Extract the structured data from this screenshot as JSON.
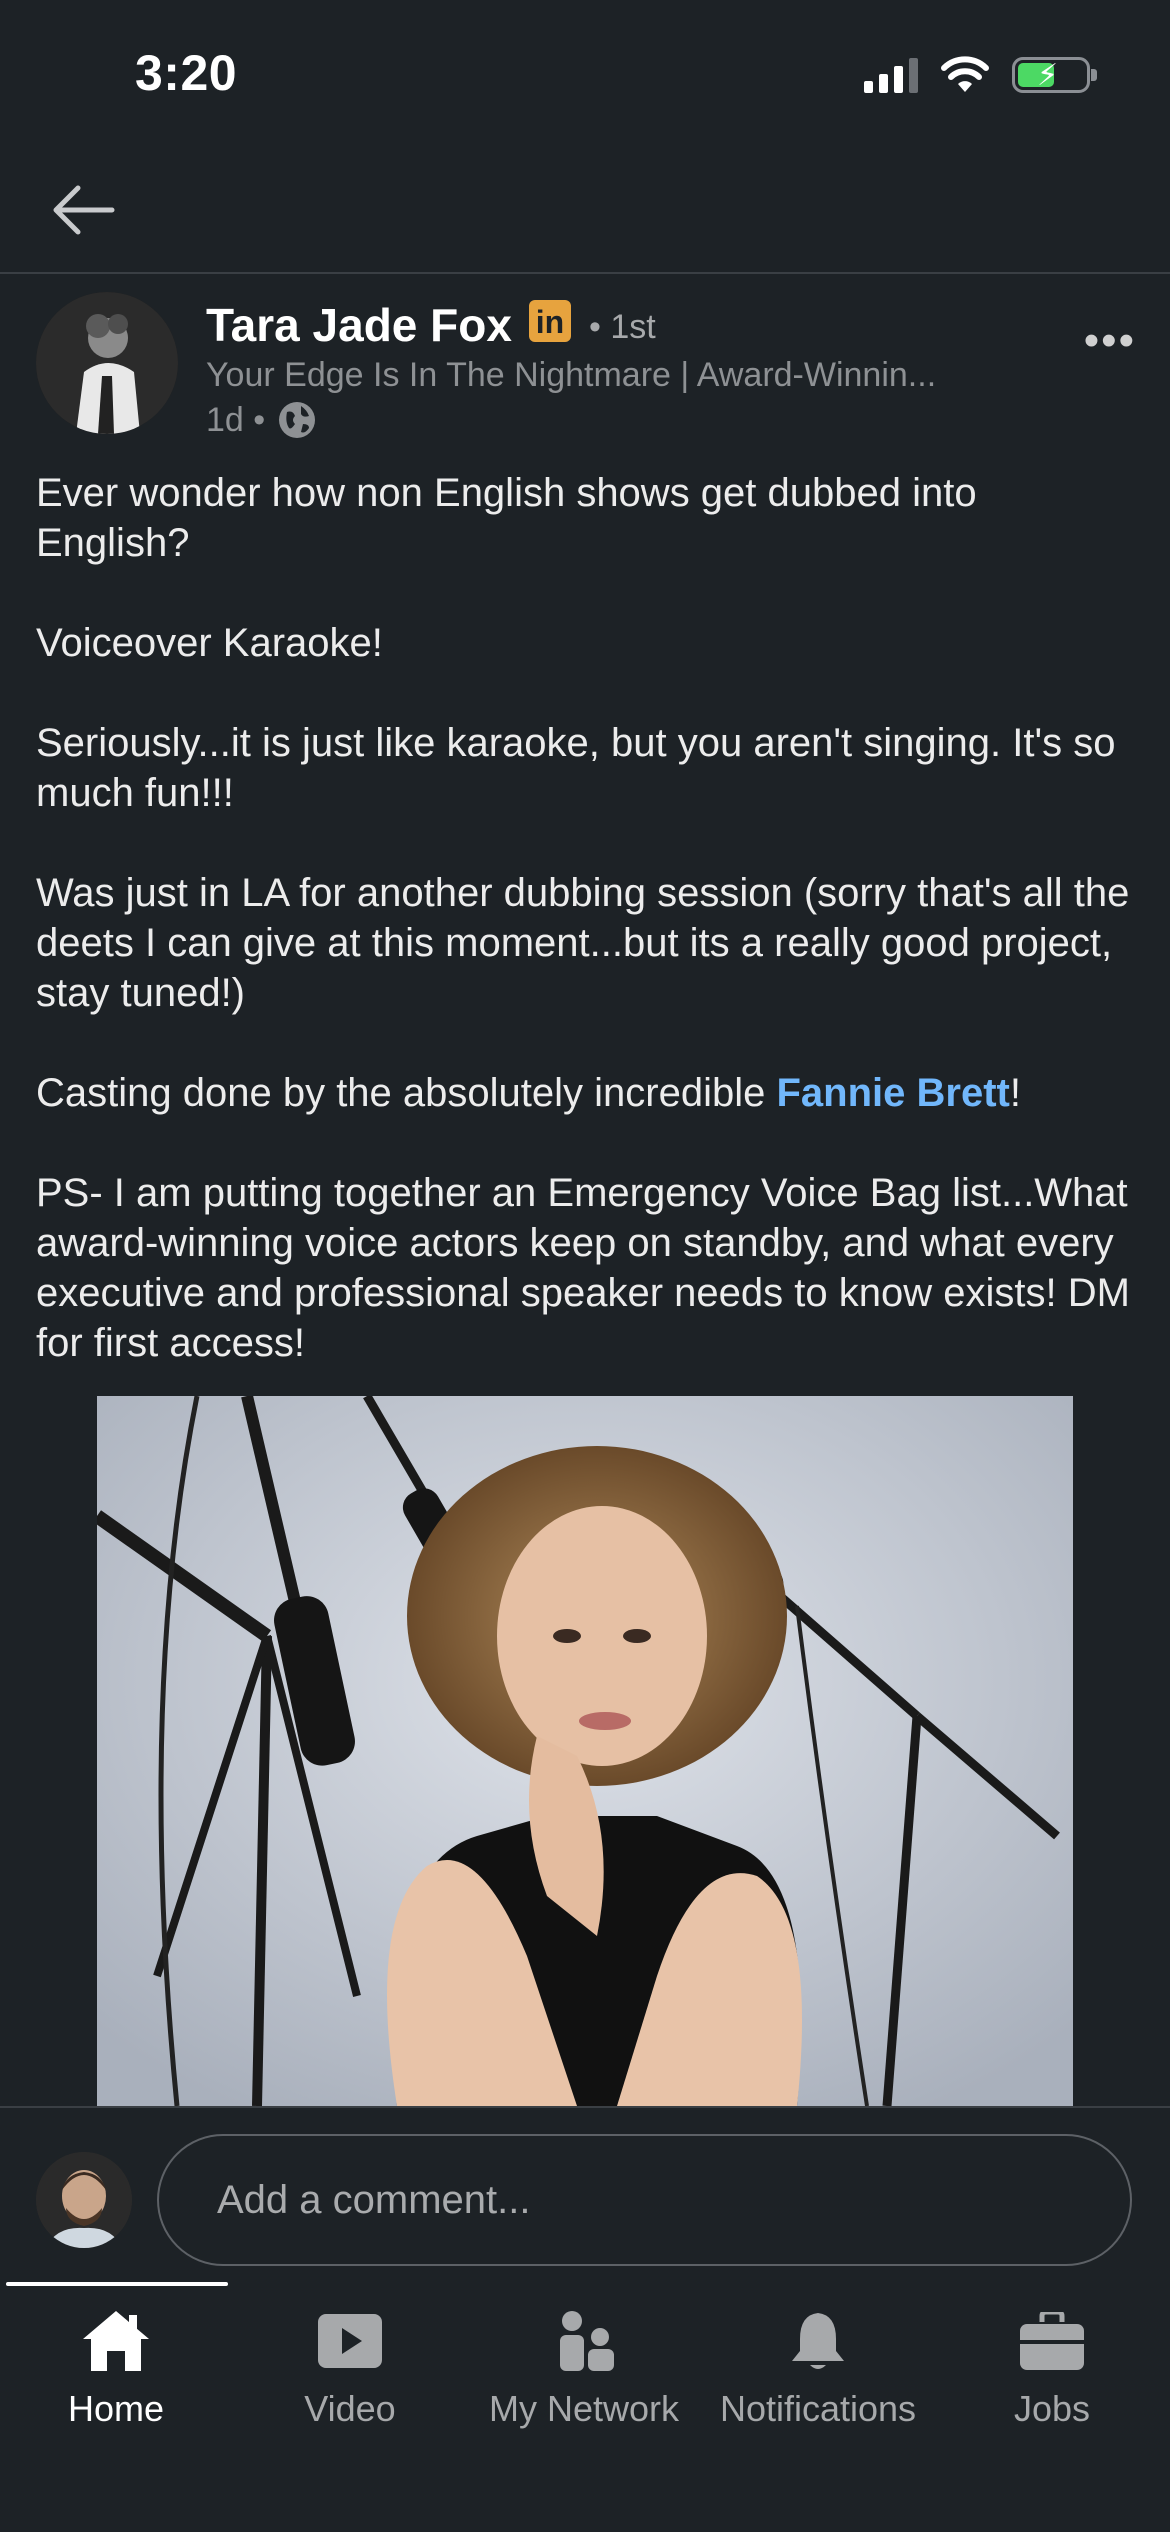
{
  "status_bar": {
    "time": "3:20"
  },
  "post": {
    "author_name": "Tara Jade Fox",
    "badge": "in",
    "degree": "• 1st",
    "headline": "Your Edge Is In The Nightmare  | Award-Winnin...",
    "age": "1d •",
    "paragraphs": [
      "Ever wonder how non English shows get dubbed into English?",
      "Voiceover Karaoke!",
      "Seriously...it is just like karaoke, but you aren't singing. It's so much fun!!!",
      "Was just in LA for another dubbing session (sorry that's all the deets I can give at this moment...but its a really good project, stay tuned!)",
      "PS- I am putting together an Emergency Voice Bag list...What award-winning voice actors keep on standby, and what every executive and professional speaker needs to know exists!  DM for first access!"
    ],
    "casting_prefix": "Casting done by the absolutely incredible ",
    "casting_mention": "Fannie Brett",
    "casting_suffix": "!"
  },
  "comment": {
    "placeholder": "Add a comment..."
  },
  "tabs": [
    {
      "label": "Home",
      "icon": "home-icon",
      "active": true
    },
    {
      "label": "Video",
      "icon": "video-icon"
    },
    {
      "label": "My Network",
      "icon": "network-icon"
    },
    {
      "label": "Notifications",
      "icon": "bell-icon"
    },
    {
      "label": "Jobs",
      "icon": "briefcase-icon"
    }
  ],
  "colors": {
    "background": "#1d2226",
    "mention": "#71b7fb",
    "badge": "#e7a33e",
    "battery": "#4cd964"
  }
}
